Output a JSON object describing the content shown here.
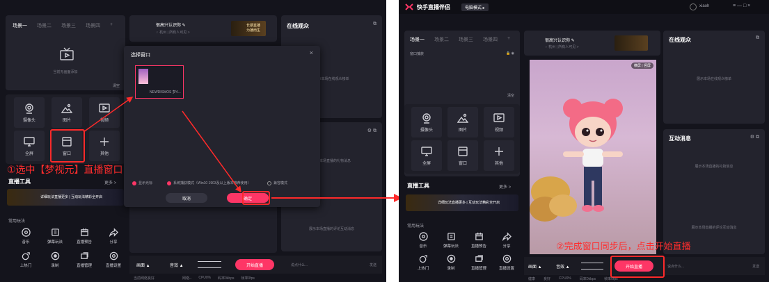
{
  "left": {
    "scene_tabs": [
      "场景一",
      "场景二",
      "场景三",
      "场景四",
      "+"
    ],
    "empty_scene": "当前无画面添加",
    "clear_label": "清空",
    "profile": {
      "name": "很高兴认识你 ✎",
      "sub": "♀ 杭州  |  所有人可见 >"
    },
    "banner_text": "长期直播 为播而生",
    "online_title": "在线观众",
    "sources": [
      {
        "label": "摄像头",
        "icon": "camera-icon"
      },
      {
        "label": "图片",
        "icon": "image-icon"
      },
      {
        "label": "视频",
        "icon": "video-icon"
      },
      {
        "label": "全屏",
        "icon": "monitor-icon"
      },
      {
        "label": "窗口",
        "icon": "window-icon"
      },
      {
        "label": "其他",
        "icon": "plus-icon"
      }
    ],
    "annotation": "①选中【梦视元】直播窗口",
    "live_tools": "直播工具",
    "more": "更多 >",
    "promo": "详细玩法直播更多 | 互动玩法精彩全开启",
    "common_play": "常用玩法",
    "tools_row1": [
      "音乐",
      "弹幕玩法",
      "直播预告",
      "分享"
    ],
    "tools_row2": [
      "上热门",
      "录制",
      "直播管理",
      "直播设置"
    ],
    "dialog": {
      "title": "选择窗口",
      "close": "×",
      "window_name": "NEWDISMOS 梦4...",
      "show_cursor": "显示光标",
      "system_capture": "系统捕获模式（Win10 1903及以上版本推荐使用）",
      "compat": "兼容模式",
      "cancel": "取消",
      "confirm": "确定"
    },
    "online_empty": "展示本场在线观众榜单",
    "gift_empty": "展示本场直播的礼物消息",
    "comment_empty": "展示本场直播的评论互动消息",
    "bottom": {
      "picture": "画面 ▲",
      "audio": "音效 ▲",
      "start": "开始直播",
      "chat": "说点什么...",
      "send": "发送",
      "status": "当前网络良好",
      "stats": [
        "网络--",
        "CPU0%",
        "码率0kbps",
        "帧率0fps"
      ]
    }
  },
  "right": {
    "app_title": "快手直播伴侣",
    "mode": "电脑模式 ▸",
    "user": "xiaoh",
    "win_controls": "≡  —  □  ×",
    "scene_tabs": [
      "场景一",
      "场景二",
      "场景三",
      "场景四",
      "+"
    ],
    "window_capture": "窗口捕获",
    "landscape_toggle": "横屏 | 竖屏",
    "clear_label": "清空",
    "profile": {
      "name": "很高兴认识你 ✎",
      "sub": "♀ 杭州  |  所有人可见 >"
    },
    "online_title": "在线观众",
    "online_empty": "展示本场在线观众榜单",
    "sources": [
      {
        "label": "摄像头",
        "icon": "camera-icon"
      },
      {
        "label": "图片",
        "icon": "image-icon"
      },
      {
        "label": "视频",
        "icon": "video-icon"
      },
      {
        "label": "全屏",
        "icon": "monitor-icon"
      },
      {
        "label": "窗口",
        "icon": "window-icon"
      },
      {
        "label": "其他",
        "icon": "plus-icon"
      }
    ],
    "live_tools": "直播工具",
    "more": "更多 >",
    "promo": "详细玩法直播更多 | 互动玩法精彩全开启",
    "common_play": "常用玩法",
    "tools_row1": [
      "音乐",
      "弹幕玩法",
      "直播预告",
      "分享"
    ],
    "tools_row2": [
      "上热门",
      "录制",
      "直播管理",
      "直播设置"
    ],
    "interact_title": "互动消息",
    "gift_empty": "展示本场直播的礼物消息",
    "comment_empty": "展示本场直播的评论互动消息",
    "annotation": "②完成窗口同步后，点击开始直播",
    "bottom": {
      "picture": "画面 ▲",
      "audio": "音效 ▲",
      "start": "开始直播",
      "chat": "说点什么...",
      "send": "发送",
      "stats": [
        "健康",
        "良好",
        "CPU0%",
        "码率0kbps",
        "帧率0fps"
      ]
    }
  },
  "colors": {
    "accent": "#fe3666",
    "annotation": "#ff2a2a",
    "panel": "#23232d",
    "bg": "#14141c"
  }
}
